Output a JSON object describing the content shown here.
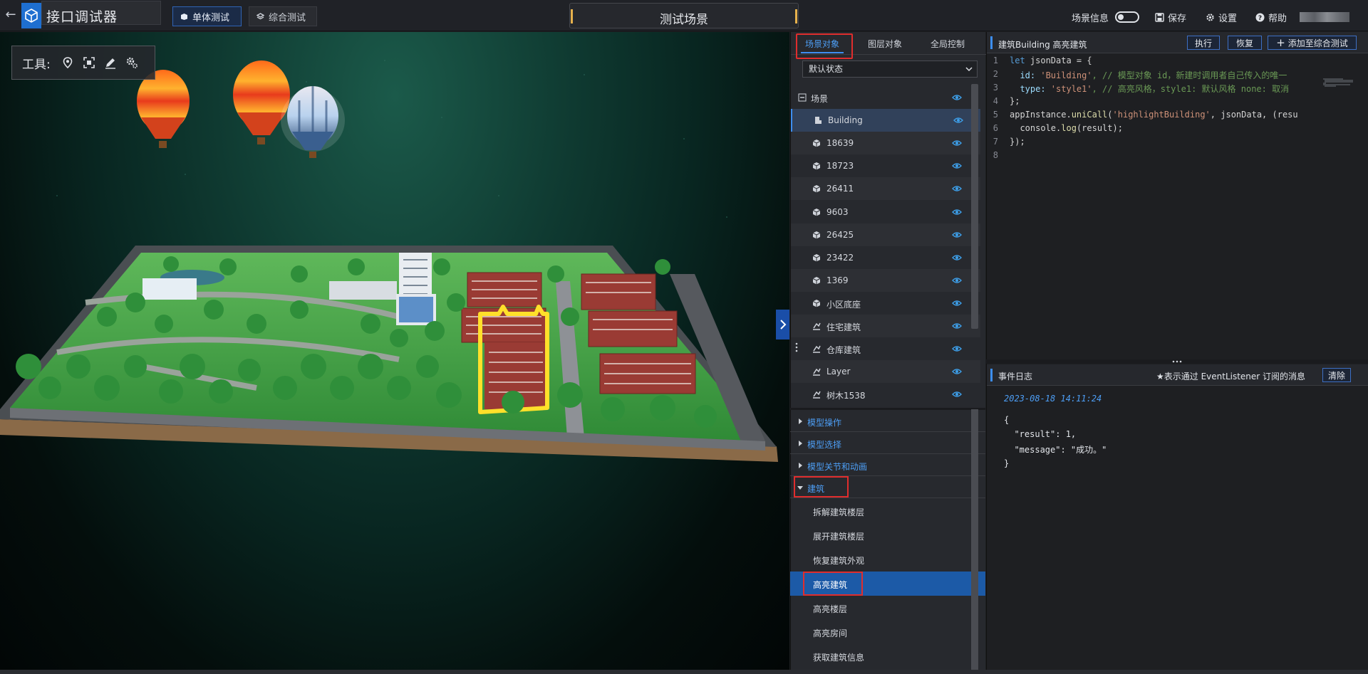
{
  "app": {
    "title": "接口调试器"
  },
  "modes": {
    "single": "单体测试",
    "combined": "综合测试"
  },
  "scene": {
    "title": "测试场景"
  },
  "topright": {
    "scene_info": "场景信息",
    "save": "保存",
    "settings": "设置",
    "help": "帮助"
  },
  "toolbar": {
    "label": "工具:",
    "tools": [
      "location-pin-icon",
      "frame-capture-icon",
      "pencil-icon",
      "settings-gears-icon"
    ]
  },
  "tabs": [
    "场景对象",
    "图层对象",
    "全局控制"
  ],
  "state_select": {
    "value": "默认状态"
  },
  "tree": {
    "root": "场景",
    "items": [
      "Building",
      "18639",
      "18723",
      "26411",
      "9603",
      "26425",
      "23422",
      "1369",
      "小区底座",
      "住宅建筑",
      "仓库建筑",
      "Layer",
      "树木1538"
    ]
  },
  "categories": [
    "模型操作",
    "模型选择",
    "模型关节和动画",
    "建筑"
  ],
  "apis": [
    "拆解建筑楼层",
    "展开建筑楼层",
    "恢复建筑外观",
    "高亮建筑",
    "高亮楼层",
    "高亮房间",
    "获取建筑信息"
  ],
  "editor": {
    "title": "建筑Building 高亮建筑",
    "run": "执行",
    "restore": "恢复",
    "add": "添加至综合测试",
    "line_numbers": [
      "1",
      "2",
      "3",
      "4",
      "5",
      "6",
      "7",
      "8"
    ],
    "code": {
      "l1_kw": "let",
      "l1_rest": " jsonData = {",
      "l2_prop": "  id: ",
      "l2_str": "'Building'",
      "l2_cm": ", // 模型对象 id，新建时调用者自己传入的唯一",
      "l3_prop": "  type: ",
      "l3_str": "'style1'",
      "l3_cm": ", // 高亮风格，style1: 默认风格 none: 取消",
      "l4": "};",
      "l5_a": "appInstance.",
      "l5_fn": "uniCall",
      "l5_b": "(",
      "l5_str": "'highlightBuilding'",
      "l5_c": ", jsonData, (resu",
      "l6_a": "  console.",
      "l6_fn": "log",
      "l6_b": "(result);",
      "l7": "});",
      "l8": ""
    }
  },
  "log": {
    "title": "事件日志",
    "hint": "★表示通过 EventListener 订阅的消息",
    "clear": "清除",
    "time": "2023-08-18 14:11:24",
    "lines": [
      "{",
      "  \"result\": 1,",
      "  \"message\": \"成功。\"",
      "}"
    ]
  },
  "colors": {
    "accent": "#3d8ef0",
    "highlight_red": "#e02d2d",
    "active_row": "#1c5aa7",
    "building_outline": "#ffe02a"
  }
}
